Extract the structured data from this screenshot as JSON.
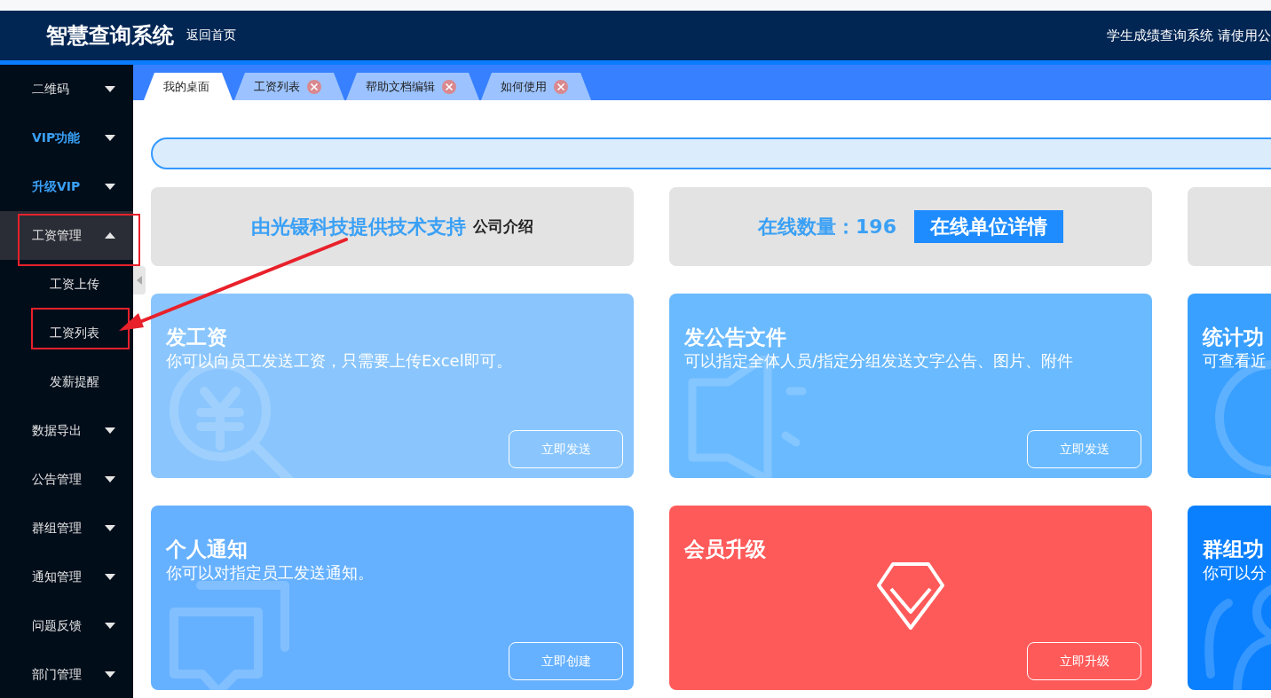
{
  "header": {
    "title": "智慧查询系统",
    "home_link": "返回首页",
    "notice": "学生成绩查询系统 请使用公"
  },
  "sidebar": {
    "items": [
      {
        "label": "二维码",
        "kind": "normal",
        "expanded": false
      },
      {
        "label": "VIP功能",
        "kind": "vip",
        "expanded": false
      },
      {
        "label": "升级VIP",
        "kind": "vip",
        "expanded": false
      },
      {
        "label": "工资管理",
        "kind": "normal",
        "expanded": true,
        "children": [
          {
            "label": "工资上传"
          },
          {
            "label": "工资列表"
          },
          {
            "label": "发薪提醒"
          }
        ]
      },
      {
        "label": "数据导出",
        "kind": "normal",
        "expanded": false
      },
      {
        "label": "公告管理",
        "kind": "normal",
        "expanded": false
      },
      {
        "label": "群组管理",
        "kind": "normal",
        "expanded": false
      },
      {
        "label": "通知管理",
        "kind": "normal",
        "expanded": false
      },
      {
        "label": "问题反馈",
        "kind": "normal",
        "expanded": false
      },
      {
        "label": "部门管理",
        "kind": "normal",
        "expanded": false
      }
    ]
  },
  "tabs": [
    {
      "label": "我的桌面",
      "selected": true
    },
    {
      "label": "工资列表",
      "selected": false
    },
    {
      "label": "帮助文档编辑",
      "selected": false
    },
    {
      "label": "如何使用",
      "selected": false
    }
  ],
  "info_cards": [
    {
      "kind": "support",
      "highlight": "由光镊科技提供技术支持",
      "link": "公司介绍"
    },
    {
      "kind": "online",
      "highlight": "在线数量：196",
      "button": "在线单位详情"
    },
    {
      "kind": "empty"
    }
  ],
  "feature_cards": [
    {
      "title": "发工资",
      "description": "你可以向员工发送工资，只需要上传Excel即可。",
      "button": "立即发送",
      "color": "#8ac6fd"
    },
    {
      "title": "发公告文件",
      "description": "可以指定全体人员/指定分组发送文字公告、图片、附件",
      "button": "立即发送",
      "color": "#6abaff"
    },
    {
      "title": "统计功",
      "description": "可查看近",
      "color": "#3aa0ff"
    },
    {
      "title": "个人通知",
      "description": "你可以对指定员工发送通知。",
      "button": "立即创建",
      "color": "#66b1ff"
    },
    {
      "title": "会员升级",
      "button": "立即升级",
      "color": "#ff5a5a"
    },
    {
      "title": "群组功",
      "description": "你可以分",
      "color": "#0a80ff"
    }
  ]
}
